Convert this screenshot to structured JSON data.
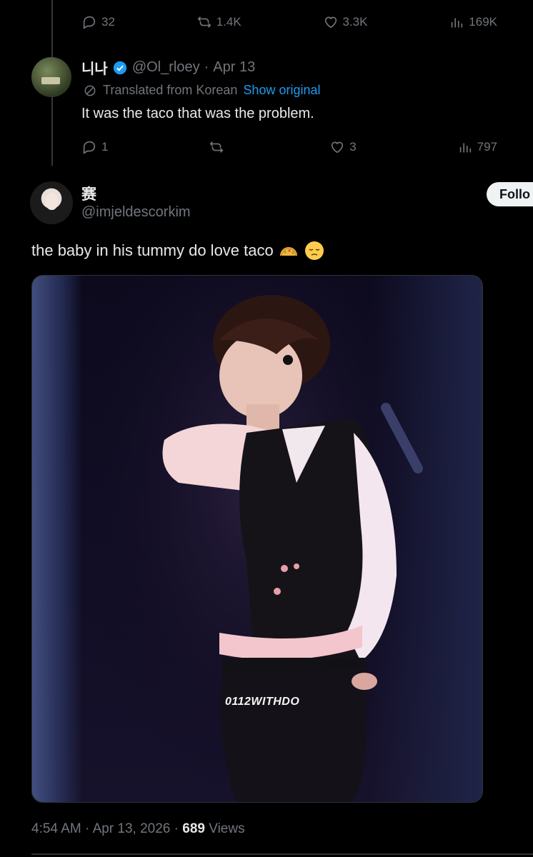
{
  "top_actions": {
    "replies": "32",
    "retweets": "1.4K",
    "likes": "3.3K",
    "views": "169K"
  },
  "reply": {
    "name": "니나",
    "handle": "@Ol_rloey",
    "separator": "·",
    "date": "Apr 13",
    "translated_label": "Translated from Korean",
    "show_original": "Show original",
    "text": "It was the taco that was the problem.",
    "actions": {
      "replies": "1",
      "retweets": "",
      "likes": "3",
      "views": "797"
    }
  },
  "main_tweet": {
    "name": "赛",
    "handle": "@imjeldescorkim",
    "follow_label": "Follo",
    "text": "the baby in his tummy do love taco",
    "emojis": [
      "taco",
      "pensive-face"
    ],
    "media_watermark": "0112WITHDO",
    "time": "4:54 AM",
    "date": "Apr 13, 2026",
    "views_count": "689",
    "views_label": "Views"
  },
  "colors": {
    "background": "#000000",
    "text": "#e7e9ea",
    "muted": "#71767b",
    "link": "#1d9bf0",
    "verified": "#1d9bf0"
  }
}
